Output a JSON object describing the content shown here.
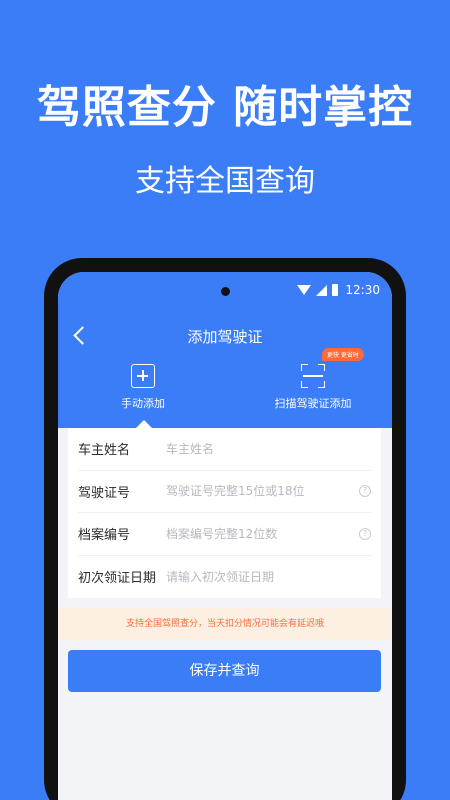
{
  "promo": {
    "headline": "驾照查分 随时掌控",
    "subline": "支持全国查询"
  },
  "status_bar": {
    "time": "12:30"
  },
  "nav": {
    "title": "添加驾驶证"
  },
  "modes": {
    "manual_label": "手动添加",
    "scan_label": "扫描驾驶证添加",
    "scan_badge": "更快 更省时"
  },
  "form": {
    "fields": [
      {
        "label": "车主姓名",
        "placeholder": "车主姓名",
        "value": "",
        "has_help": false
      },
      {
        "label": "驾驶证号",
        "placeholder": "驾驶证号完整15位或18位",
        "value": "",
        "has_help": true
      },
      {
        "label": "档案编号",
        "placeholder": "档案编号完整12位数",
        "value": "",
        "has_help": true
      },
      {
        "label": "初次领证日期",
        "placeholder": "请输入初次领证日期",
        "value": "",
        "has_help": false
      }
    ],
    "help_glyph": "?"
  },
  "notice": "支持全国驾照查分，当天扣分情况可能会有延迟哦",
  "submit_label": "保存并查询",
  "colors": {
    "brand_blue": "#3a7df6",
    "accent_orange": "#ff6a39",
    "notice_bg": "#fdf0e3"
  },
  "icons": {
    "back": "chevron-left-icon",
    "manual": "plus-square-icon",
    "scan": "scan-frame-icon",
    "wifi": "wifi-icon",
    "signal": "signal-icon",
    "battery": "battery-icon",
    "help": "question-circle-icon"
  }
}
